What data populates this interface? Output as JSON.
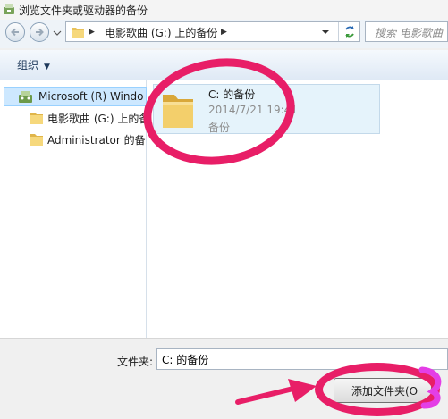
{
  "window": {
    "title": "浏览文件夹或驱动器的备份"
  },
  "address_bar": {
    "path": "电影歌曲 (G:) 上的备份"
  },
  "search": {
    "placeholder": "搜索 电影歌曲"
  },
  "toolbar": {
    "organize_label": "组织"
  },
  "nav_tree": {
    "root": {
      "label": "Microsoft (R) Windo"
    },
    "items": [
      {
        "label": "电影歌曲 (G:) 上的备"
      },
      {
        "label": "Administrator 的备"
      }
    ]
  },
  "file_item": {
    "name": "C: 的备份",
    "date": "2014/7/21 19:41",
    "type": "备份"
  },
  "bottom": {
    "folder_label": "文件夹:",
    "folder_value": "C: 的备份",
    "add_button_label": "添加文件夹(O"
  },
  "colors": {
    "annotation": "#e81e67",
    "selection_bg": "#cde8ff",
    "folder_yellow": "#f3cf6b"
  },
  "icons": [
    "backup-app-icon",
    "back-arrow-icon",
    "forward-arrow-icon",
    "folder-icon",
    "refresh-icon",
    "windows-backup-icon"
  ]
}
